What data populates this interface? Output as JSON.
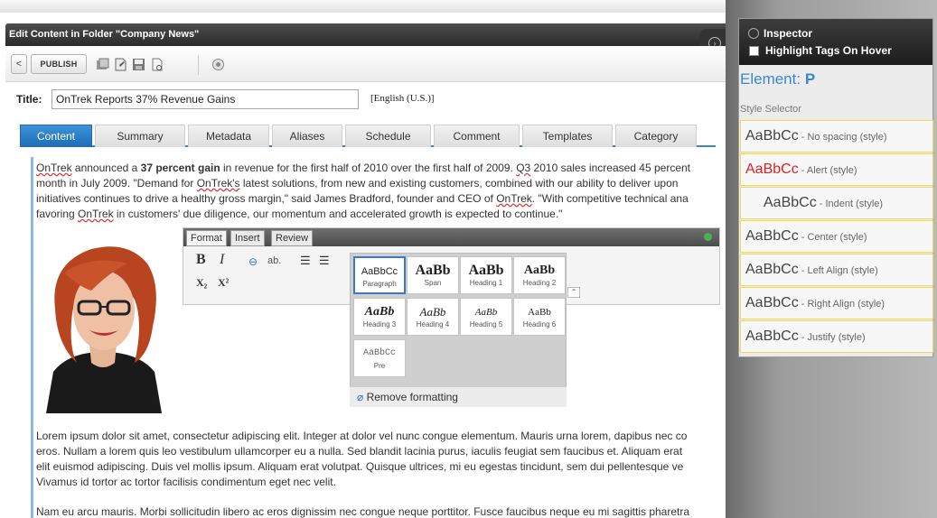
{
  "window": {
    "title": "Edit Content in Folder \"Company News\""
  },
  "toolbar": {
    "back_glyph": "<",
    "publish_label": "PUBLISH"
  },
  "title_field": {
    "label": "Title:",
    "value": "OnTrek Reports 37% Revenue Gains",
    "language": "[English (U.S.)]"
  },
  "tabs": [
    "Content",
    "Summary",
    "Metadata",
    "Aliases",
    "Schedule",
    "Comment",
    "Templates",
    "Category"
  ],
  "active_tab": "Content",
  "body": {
    "p1": {
      "line1_a": "OnTrek",
      "line1_b": " announced a ",
      "line1_bold": "37 percent gain",
      "line1_c": " in revenue for the first half of 2010 over the first half of 2009.  ",
      "line1_d": "Q3",
      "line1_e": " 2010 sales increased 45 percent",
      "line2_a": "month in July 2009.  \"Demand for ",
      "line2_b": "OnTrek's",
      "line2_c": " latest solutions, from new and existing customers, combined with our ability to deliver upon",
      "line3_a": "initiatives continues to drive a healthy gross margin,\" said James Bradford, founder and CEO of ",
      "line3_b": "OnTrek",
      "line3_c": ".  \"With competitive technical ana",
      "line4_a": "favoring ",
      "line4_b": "OnTrek",
      "line4_c": " in customers' due diligence, our momentum and accelerated growth is expected to continue.\""
    },
    "lorem": [
      "Lorem ipsum dolor sit amet, consectetur adipiscing elit. Integer at dolor vel nunc congue elementum. Mauris urna lorem, dapibus nec co",
      "eros. Nullam a lorem quis leo vestibulum ullamcorper eu a nulla. Sed blandit lacinia purus, iaculis feugiat sem faucibus et. Aliquam erat",
      "elit euismod adipiscing. Duis vel mollis ipsum. Aliquam erat volutpat. Quisque ultrices, mi eu egestas tincidunt, sem dui pellentesque ve",
      "Vivamus id tortor ac tortor facilisis condimentum eget nec velit."
    ],
    "nam": "Nam eu arcu mauris. Morbi sollicitudin libero ac eros dignissim nec congue neque porttitor. Fusce faucibus neque eu mi sagittis pharetra"
  },
  "format_popup": {
    "tabs": [
      "Format",
      "Insert",
      "Review"
    ],
    "tools": {
      "bold": "B",
      "italic": "I",
      "abbr": "ab.",
      "subscript": "X₂",
      "superscript": "X²"
    },
    "styles": [
      {
        "sample": "AaBbCc",
        "name": "Paragraph"
      },
      {
        "sample": "AaBb",
        "name": "Span"
      },
      {
        "sample": "AaBb",
        "name": "Heading 1"
      },
      {
        "sample": "AaBb",
        "name": "Heading 2"
      },
      {
        "sample": "AaBb",
        "name": "Heading 3"
      },
      {
        "sample": "AaBb",
        "name": "Heading 4"
      },
      {
        "sample": "AaBb",
        "name": "Heading 5"
      },
      {
        "sample": "AaBb",
        "name": "Heading 6"
      },
      {
        "sample": "AaBbCc",
        "name": "Pre"
      }
    ],
    "remove_formatting": "Remove formatting"
  },
  "inspector": {
    "title": "Inspector",
    "highlight_label": "Highlight Tags On Hover",
    "element_label": "Element:",
    "element_value": "P",
    "style_selector_label": "Style Selector",
    "style_items": [
      {
        "sample": "AaBbCc",
        "desc": " - No spacing (style)"
      },
      {
        "sample": "AaBbCc",
        "desc": " - Alert (style)"
      },
      {
        "sample": "AaBbCc",
        "desc": " - Indent (style)"
      },
      {
        "sample": "AaBbCc",
        "desc": " - Center (style)"
      },
      {
        "sample": "AaBbCc",
        "desc": " - Left Align (style)"
      },
      {
        "sample": "AaBbCc",
        "desc": " - Right Align (style)"
      },
      {
        "sample": "AaBbCc",
        "desc": " - Justify (style)"
      }
    ]
  },
  "colors": {
    "accent": "#1c6db5",
    "alert": "#e02020",
    "inspector_element": "#3a87d6"
  }
}
